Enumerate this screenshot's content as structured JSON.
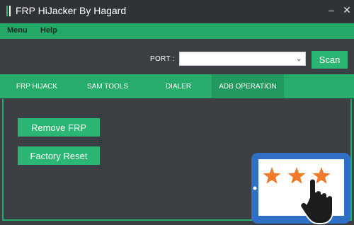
{
  "window": {
    "title": "FRP HiJacker By Hagard",
    "minimize_label": "–",
    "close_label": "✕"
  },
  "menu": [
    {
      "label": "Menu"
    },
    {
      "label": "Help"
    }
  ],
  "port": {
    "label": "PORT :",
    "value": ""
  },
  "scan_label": "Scan",
  "tabs": [
    {
      "label": "FRP HIJACK"
    },
    {
      "label": "SAM TOOLS"
    },
    {
      "label": "DIALER"
    },
    {
      "label": "ADB OPERATION",
      "active": true
    }
  ],
  "actions": {
    "remove_frp": "Remove FRP",
    "factory_reset": "Factory Reset"
  },
  "colors": {
    "accent": "#28ac6b",
    "button": "#2bb673",
    "background": "#3b3f44",
    "titlebar": "#2f3337",
    "star": "#f07a2a",
    "tablet": "#2f6fc4"
  },
  "overlay": {
    "stars": 3
  }
}
